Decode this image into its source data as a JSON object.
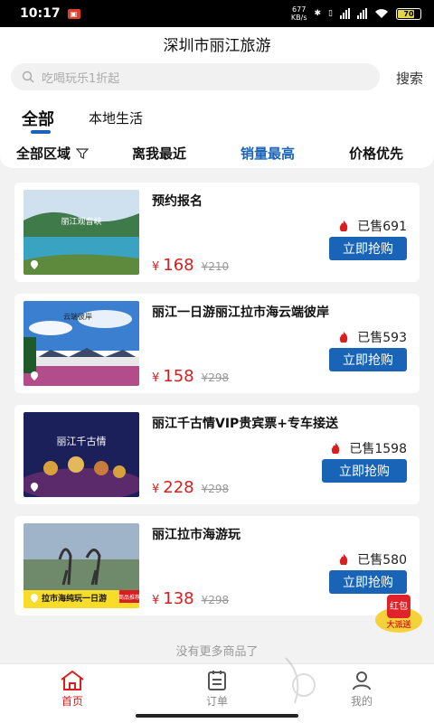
{
  "status_bar": {
    "time": "10:17",
    "net_speed_value": "677",
    "net_speed_unit": "KB/s",
    "battery": "70"
  },
  "header": {
    "title": "深圳市丽江旅游"
  },
  "search": {
    "placeholder": "吃喝玩乐1折起",
    "button": "搜索"
  },
  "tabs": {
    "all": "全部",
    "local": "本地生活"
  },
  "filters": {
    "region": "全部区域",
    "nearest": "离我最近",
    "sales": "销量最高",
    "price": "价格优先"
  },
  "products": [
    {
      "title": "预约报名",
      "sold": "已售691",
      "buy": "立即抢购",
      "currency": "¥",
      "price": "168",
      "original": "¥210",
      "image_text": "丽江观音峡"
    },
    {
      "title": "丽江一日游丽江拉市海云端彼岸",
      "sold": "已售593",
      "buy": "立即抢购",
      "currency": "¥",
      "price": "158",
      "original": "¥298",
      "image_text": "云端彼岸"
    },
    {
      "title": "丽江千古情VIP贵宾票+专车接送",
      "sold": "已售1598",
      "buy": "立即抢购",
      "currency": "¥",
      "price": "228",
      "original": "¥298",
      "image_text": "丽江千古情"
    },
    {
      "title": "丽江拉市海游玩",
      "sold": "已售580",
      "buy": "立即抢购",
      "currency": "¥",
      "price": "138",
      "original": "¥298",
      "image_text": "拉市海纯玩一日游",
      "image_badge": "商品推荐"
    }
  ],
  "no_more": "没有更多商品了",
  "red_packet": {
    "line1": "红包",
    "line2": "大派送"
  },
  "bottom_nav": {
    "home": "首页",
    "orders": "订单",
    "mine": "我的"
  },
  "colors": {
    "accent": "#1a64b8",
    "price": "#d81e1e"
  }
}
